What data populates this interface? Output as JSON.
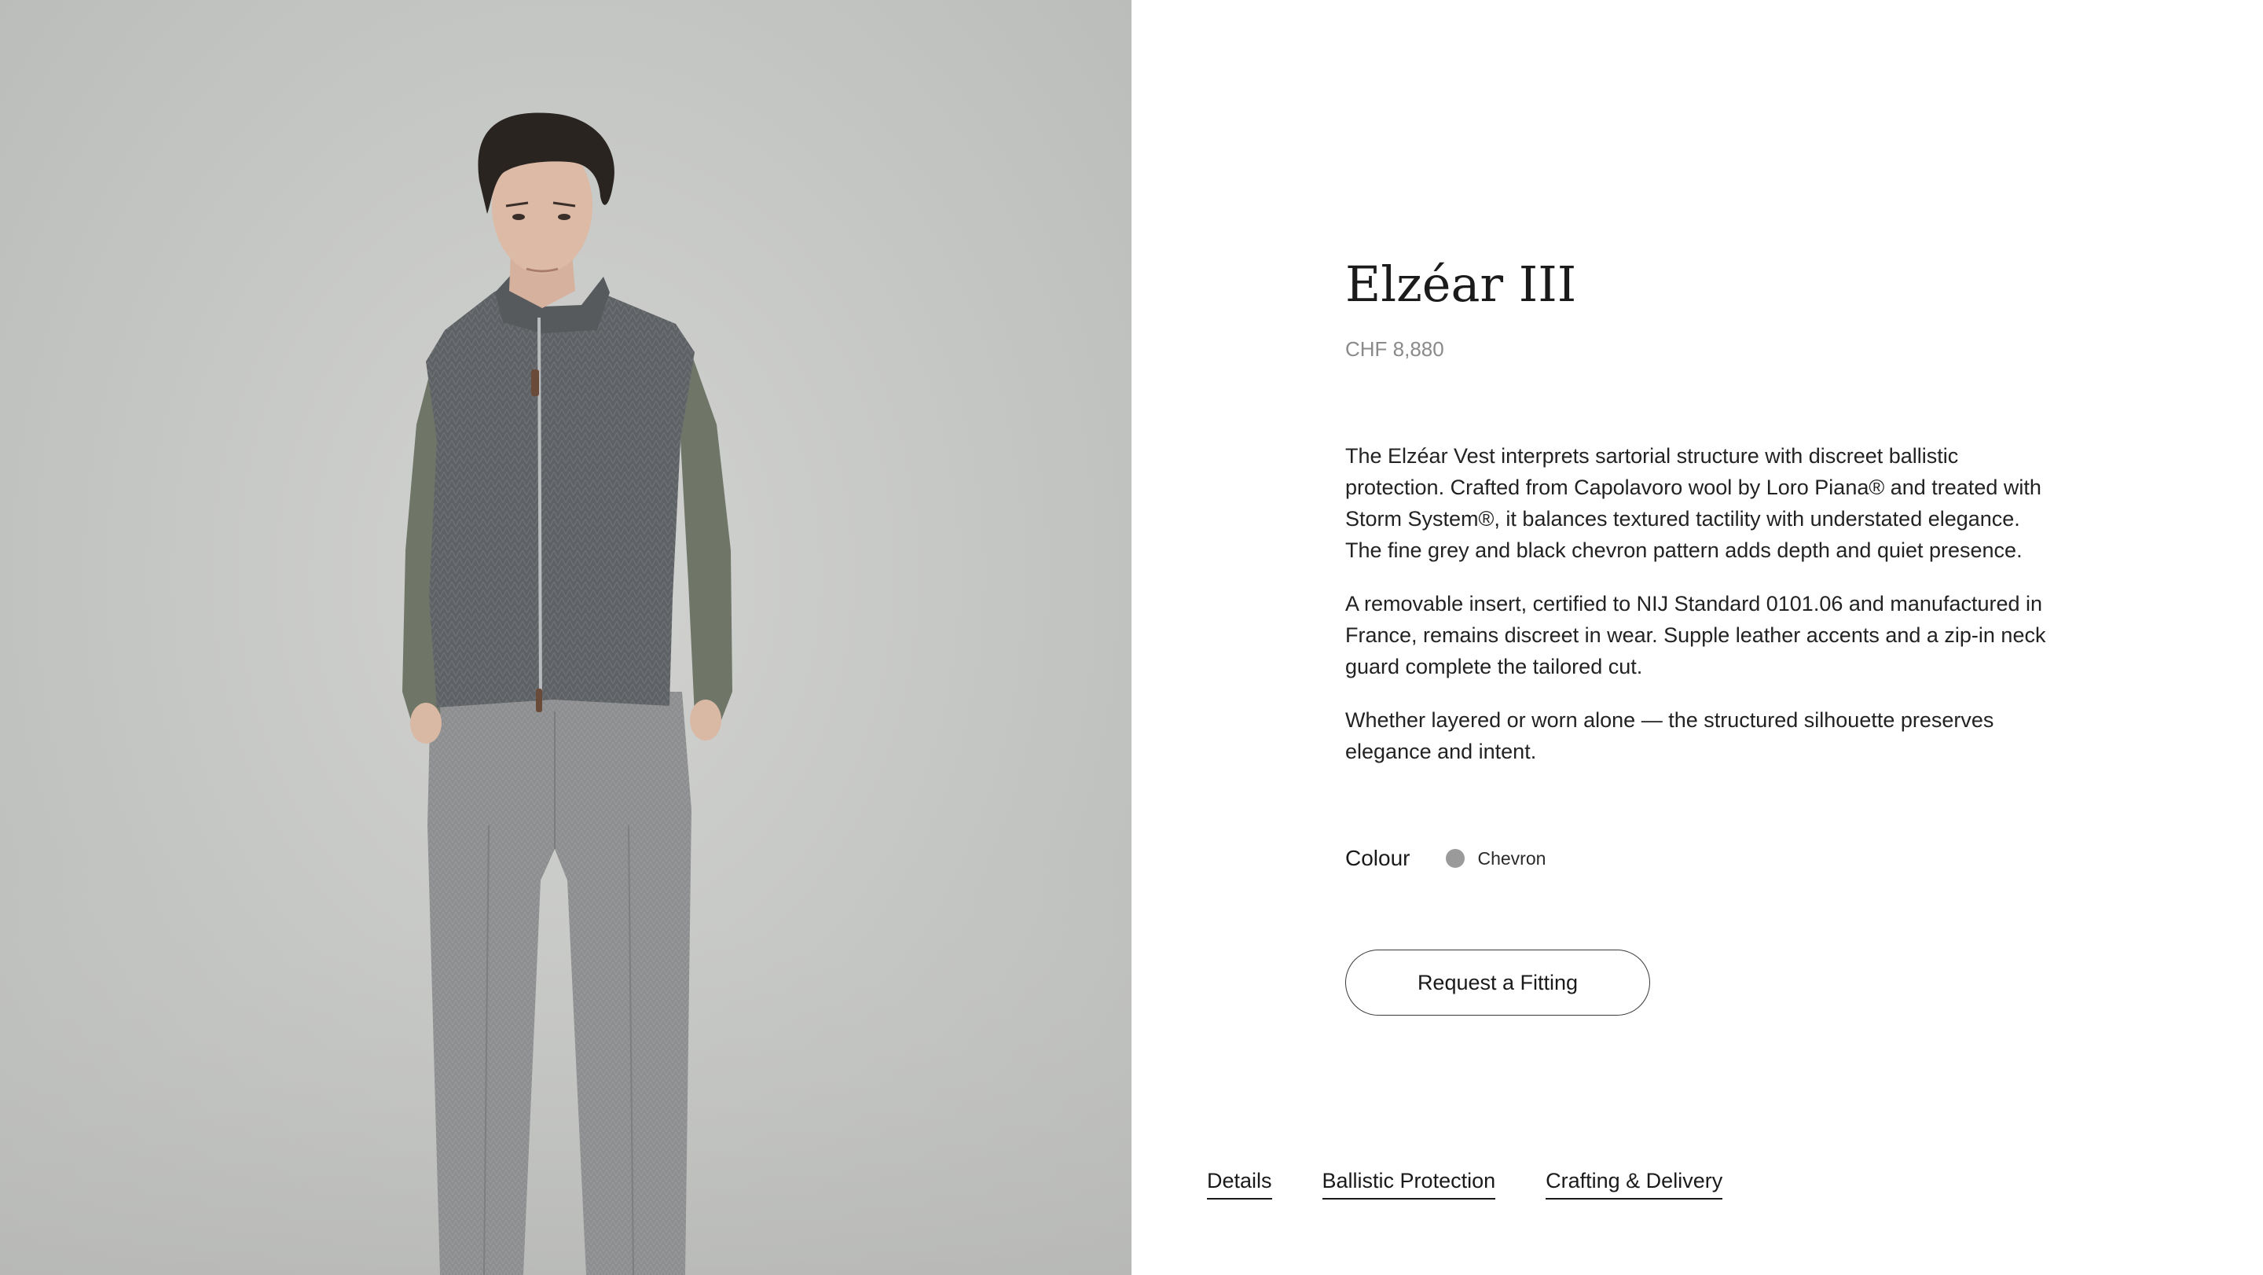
{
  "product": {
    "title": "Elzéar III",
    "price": "CHF 8,880",
    "description": [
      "The Elzéar Vest interprets sartorial structure with discreet ballistic protection. Crafted from Capolavoro wool by Loro Piana® and treated with Storm System®, it balances textured tactility with understated elegance. The fine grey and black chevron pattern adds depth and quiet presence.",
      "A removable insert, certified to NIJ Standard 0101.06 and manufactured in France, remains discreet in wear. Supple leather accents and a zip-in neck guard complete the tailored cut.",
      "Whether layered or worn alone — the structured silhouette preserves elegance and intent."
    ]
  },
  "colour": {
    "label": "Colour",
    "selected": "Chevron",
    "swatch_color": "#9a9a9a"
  },
  "cta": {
    "fitting_label": "Request a Fitting"
  },
  "tabs": [
    {
      "label": "Details"
    },
    {
      "label": "Ballistic Protection"
    },
    {
      "label": "Crafting & Delivery"
    }
  ]
}
